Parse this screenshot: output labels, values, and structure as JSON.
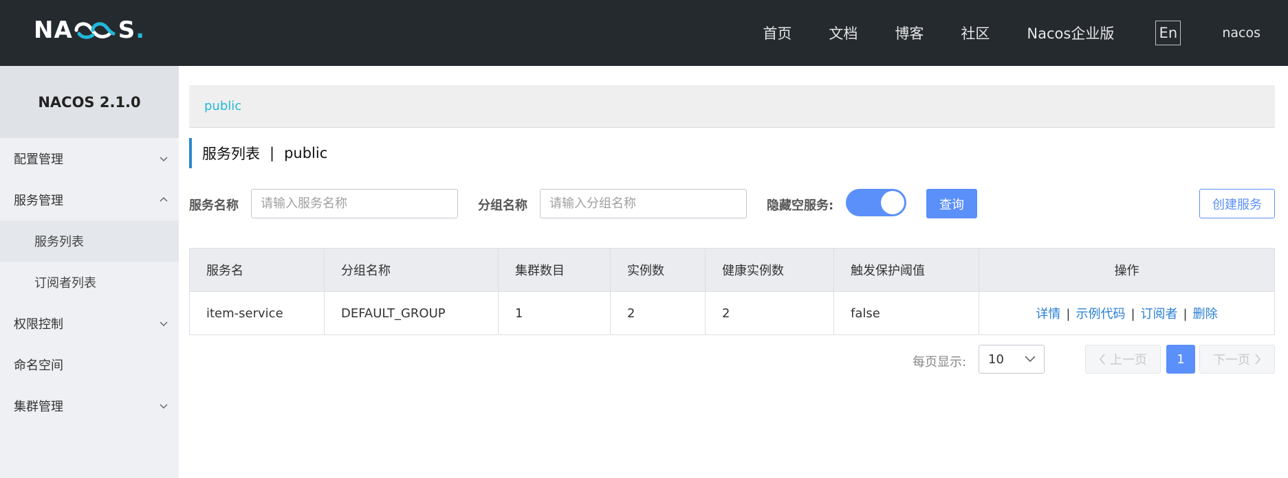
{
  "header": {
    "logo_left": "NA",
    "logo_right": "S",
    "logo_dot": ".",
    "nav": [
      {
        "label": "首页"
      },
      {
        "label": "文档"
      },
      {
        "label": "博客"
      },
      {
        "label": "社区"
      },
      {
        "label": "Nacos企业版"
      }
    ],
    "lang_button": "En",
    "username": "nacos"
  },
  "sidebar": {
    "title": "NACOS 2.1.0",
    "items": [
      {
        "label": "配置管理",
        "icon": "chevron-down-icon"
      },
      {
        "label": "服务管理",
        "icon": "chevron-up-icon"
      },
      {
        "label": "服务列表"
      },
      {
        "label": "订阅者列表"
      },
      {
        "label": "权限控制",
        "icon": "chevron-down-icon"
      },
      {
        "label": "命名空间"
      },
      {
        "label": "集群管理",
        "icon": "chevron-down-icon"
      }
    ]
  },
  "namespace_bar": {
    "link": "public"
  },
  "page": {
    "title": "服务列表",
    "separator": "|",
    "namespace": "public"
  },
  "filters": {
    "service_name_label": "服务名称",
    "service_name_placeholder": "请输入服务名称",
    "group_name_label": "分组名称",
    "group_name_placeholder": "请输入分组名称",
    "hide_empty_label": "隐藏空服务:",
    "hide_empty_on": true,
    "query_button": "查询",
    "create_button": "创建服务"
  },
  "table": {
    "columns": [
      "服务名",
      "分组名称",
      "集群数目",
      "实例数",
      "健康实例数",
      "触发保护阈值",
      "操作"
    ],
    "rows": [
      {
        "service": "item-service",
        "group": "DEFAULT_GROUP",
        "clusters": "1",
        "instances": "2",
        "healthy": "2",
        "threshold": "false",
        "actions": [
          "详情",
          "示例代码",
          "订阅者",
          "删除"
        ]
      }
    ]
  },
  "pagination": {
    "per_page_label": "每页显示:",
    "per_page_value": "10",
    "prev": "上一页",
    "current": "1",
    "next": "下一页"
  },
  "colors": {
    "header_bg": "#252a2f",
    "accent": "#5b8ff9",
    "link": "#2a7fd4",
    "namespace_link": "#22b8d8"
  }
}
